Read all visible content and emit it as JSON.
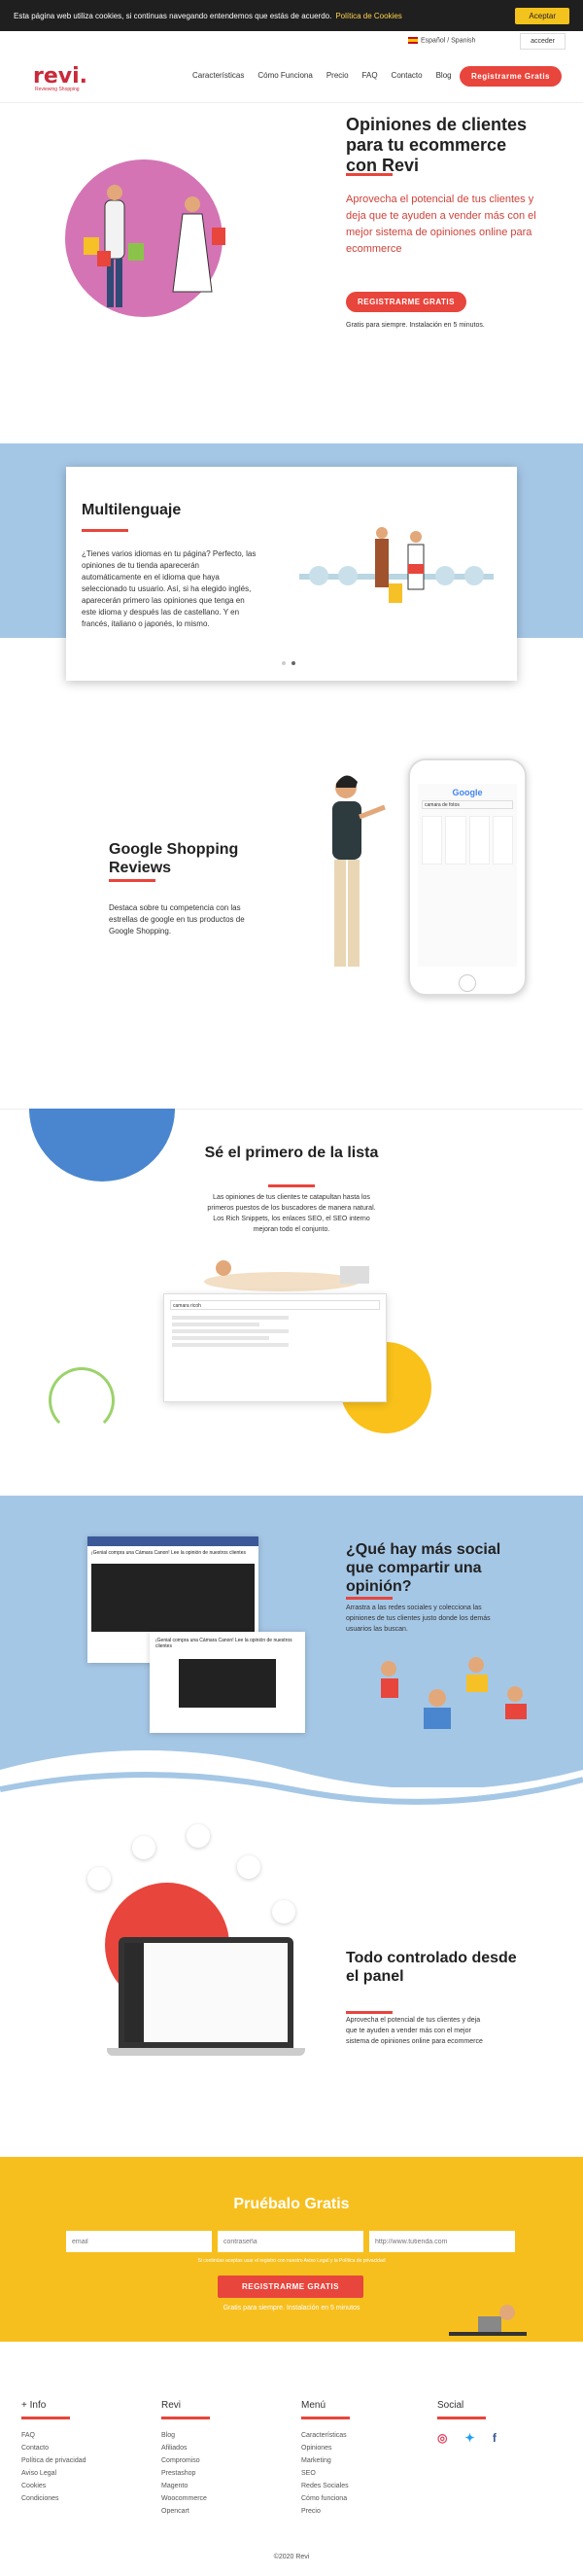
{
  "cookie": {
    "text": "Esta página web utiliza cookies, si continuas navegando entendemos que estás de acuerdo.",
    "link": "Política de Cookies",
    "accept": "Aceptar"
  },
  "topbar": {
    "language": "Español / Spanish",
    "login": "acceder"
  },
  "header": {
    "logo": "revi.",
    "tagline": "Reviewing Shopping",
    "nav": [
      "Características",
      "Cómo Funciona",
      "Precio",
      "FAQ",
      "Contacto",
      "Blog"
    ],
    "cta": "Registrarme Gratis"
  },
  "hero": {
    "title": "Opiniones de clientes para tu ecommerce con Revi",
    "description": "Aprovecha el potencial de tus clientes y deja que te ayuden a vender más con el mejor sistema de opiniones online para ecommerce",
    "button": "REGISTRARME GRATIS",
    "note": "Gratis para siempre. Instalación en 5 minutos."
  },
  "multilenguaje": {
    "title": "Multilenguaje",
    "text": "¿Tienes varios idiomas en tu página? Perfecto, las opiniones de tu tienda aparecerán automáticamente en el idioma que haya seleccionado tu usuario. Así, si ha elegido inglés, aparecerán primero las opiniones que tenga en este idioma y después las de castellano. Y en francés, italiano o japonés, lo mismo."
  },
  "google_shopping": {
    "title": "Google Shopping Reviews",
    "text": "Destaca sobre tu competencia con las estrellas de google en tus productos de Google Shopping.",
    "phone_search": "camara de fotos",
    "phone_logo": "Google"
  },
  "primero": {
    "title": "Sé el primero de la lista",
    "text": "Las opiniones de tus clientes te catapultan hasta los primeros puestos de los buscadores de manera natural. Los Rich Snippets, los enlaces SEO, el SEO interno mejoran todo el conjunto.",
    "serp_query": "camara ricoh"
  },
  "social": {
    "title": "¿Qué hay más social que compartir una opinión?",
    "text": "Arrastra a las redes sociales y colecciona las opiniones de tus clientes justo donde los demás usuarios las buscan.",
    "card1_text": "¡Genial compra una Cámara Canon! Lee la opinión de nuestros clientes",
    "card2_text": "¡Genial compra una Cámara Canon! Lee la opinión de nuestros clientes"
  },
  "panel": {
    "title": "Todo controlado desde el panel",
    "text": "Aprovecha el potencial de tus clientes y deja que te ayuden a vender más con el mejor sistema de opiniones online para ecommerce"
  },
  "cta": {
    "title": "Pruébalo Gratis",
    "email_placeholder": "email",
    "password_placeholder": "contraseña",
    "url_placeholder": "http://www.tutienda.com",
    "legal": "Si continúas aceptas usar el registro con nuestro Aviso Legal y la Política de privacidad",
    "button": "REGISTRARME GRATIS",
    "note": "Gratis para siempre. Instalación en 5 minutos"
  },
  "footer": {
    "columns": [
      {
        "title": "+ Info",
        "items": [
          "FAQ",
          "Contacto",
          "Política de privacidad",
          "Aviso Legal",
          "Cookies",
          "Condiciones"
        ]
      },
      {
        "title": "Revi",
        "items": [
          "Blog",
          "Afiliados",
          "Compromiso",
          "Prestashop",
          "Magento",
          "Woocommerce",
          "Opencart"
        ]
      },
      {
        "title": "Menú",
        "items": [
          "Características",
          "Opiniones",
          "Marketing",
          "SEO",
          "Redes Sociales",
          "Cómo funciona",
          "Precio"
        ]
      },
      {
        "title": "Social",
        "items": []
      }
    ],
    "copyright": "©2020 Revi"
  },
  "colors": {
    "accent": "#e8453c",
    "blue": "#a5c7e6",
    "yellow": "#f7bf1e",
    "pink": "#d474b4"
  },
  "icons": [
    "instagram-icon",
    "twitter-icon",
    "facebook-icon"
  ]
}
